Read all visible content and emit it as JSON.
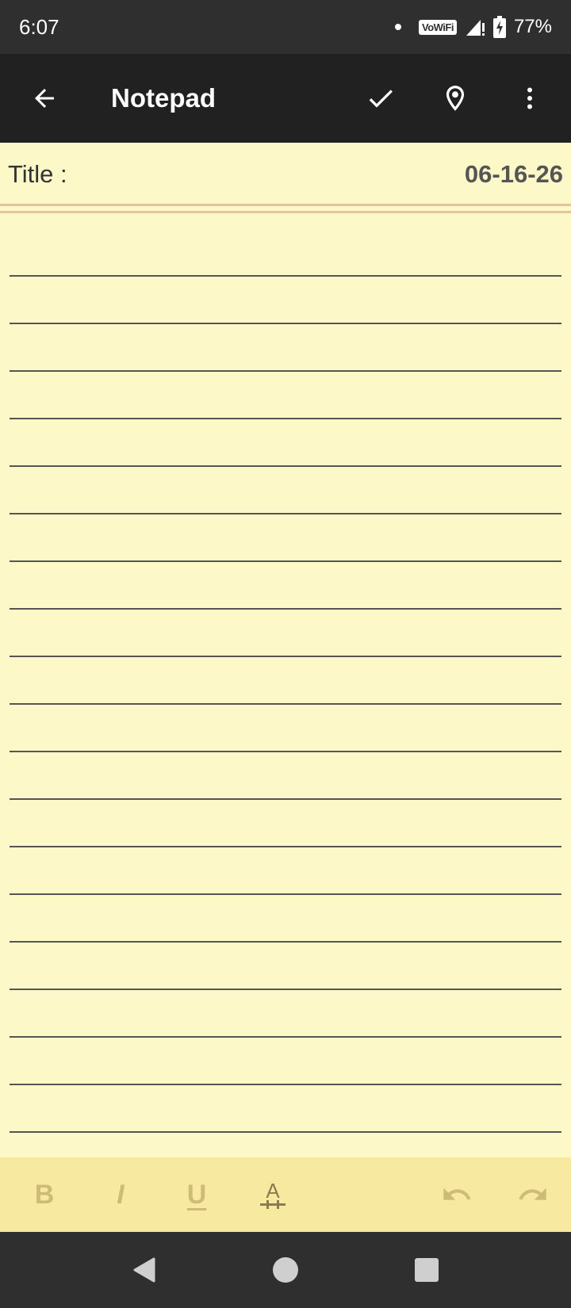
{
  "status_bar": {
    "time": "6:07",
    "network_label": "VoWiFi",
    "battery_text": "77%"
  },
  "app_bar": {
    "title": "Notepad",
    "icons": [
      "back-arrow-icon",
      "check-icon",
      "location-pin-icon",
      "more-vert-icon"
    ]
  },
  "note": {
    "title_label": "Title :",
    "title_value": "",
    "date": "06-16-26",
    "body_value": ""
  },
  "format_toolbar": {
    "bold_label": "B",
    "italic_label": "I",
    "underline_label": "U",
    "text_style_label": "A",
    "icons": [
      "undo-icon",
      "redo-icon"
    ]
  },
  "colors": {
    "paper": "#fcf8c8",
    "toolbar": "#f7e9a0",
    "app_bar": "#212121",
    "status_bar": "#2f2f2f",
    "rule": "#e7c3a0"
  }
}
